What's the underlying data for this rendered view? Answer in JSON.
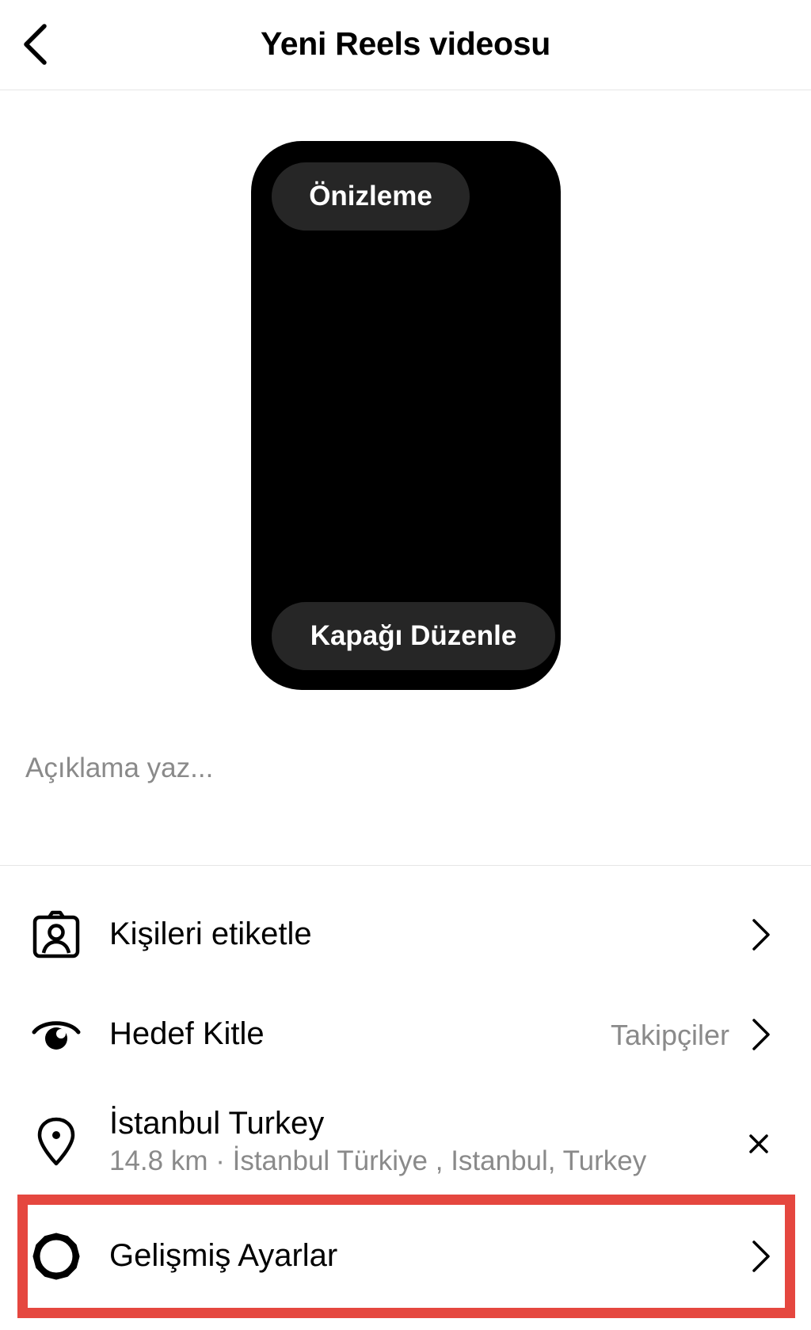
{
  "header": {
    "title": "Yeni Reels videosu",
    "back_icon": "chevron-left-icon"
  },
  "preview": {
    "preview_label": "Önizleme",
    "edit_cover_label": "Kapağı Düzenle"
  },
  "caption": {
    "placeholder": "Açıklama yaz...",
    "value": ""
  },
  "rows": {
    "tag_people": {
      "label": "Kişileri etiketle",
      "icon": "tag-person-icon"
    },
    "audience": {
      "label": "Hedef Kitle",
      "value": "Takipçiler",
      "icon": "eye-icon"
    },
    "location": {
      "label": "İstanbul Turkey",
      "sub": "14.8 km · İstanbul Türkiye , Istanbul, Turkey",
      "icon": "location-pin-icon"
    },
    "advanced": {
      "label": "Gelişmiş Ayarlar",
      "icon": "gear-icon"
    }
  },
  "colors": {
    "highlight": "#e5473f",
    "secondary_text": "#8a8a8a",
    "pill_bg": "#262626"
  }
}
